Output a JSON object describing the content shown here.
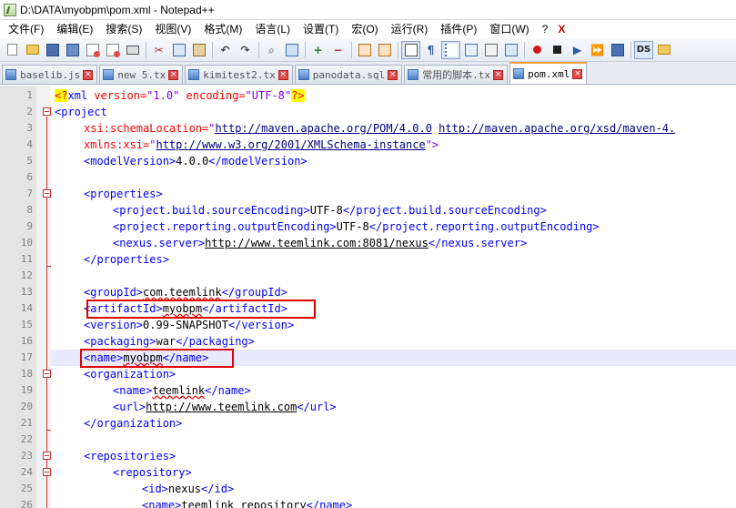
{
  "window": {
    "title": "D:\\DATA\\myobpm\\pom.xml - Notepad++"
  },
  "menu": {
    "items": [
      "文件(F)",
      "编辑(E)",
      "搜索(S)",
      "视图(V)",
      "格式(M)",
      "语言(L)",
      "设置(T)",
      "宏(O)",
      "运行(R)",
      "插件(P)",
      "窗口(W)",
      "?"
    ],
    "close_label": "X"
  },
  "toolbar": {
    "icons": [
      "new-file-icon",
      "open-file-icon",
      "save-icon",
      "save-all-icon",
      "close-icon",
      "close-all-icon",
      "print-icon",
      "cut-icon",
      "copy-icon",
      "paste-icon",
      "undo-icon",
      "redo-icon",
      "find-icon",
      "replace-icon",
      "zoom-in-icon",
      "zoom-out-icon",
      "sync-vertical-icon",
      "sync-horizontal-icon",
      "word-wrap-icon",
      "show-all-chars-icon",
      "indent-guide-icon",
      "user-lang-icon",
      "doc-map-icon",
      "function-list-icon",
      "record-macro-icon",
      "stop-record-icon",
      "play-macro-icon",
      "run-macro-multiple-icon",
      "save-macro-icon",
      "ds-plugin-icon",
      "folder-plugin-icon"
    ],
    "ds_label": "DS"
  },
  "tabs": [
    {
      "label": "baselib.js",
      "active": false
    },
    {
      "label": "new  5.tx",
      "active": false
    },
    {
      "label": "kimitest2.tx",
      "active": false
    },
    {
      "label": "panodata.sql",
      "active": false
    },
    {
      "label": "常用的脚本.tx",
      "active": false
    },
    {
      "label": "pom.xml",
      "active": true
    }
  ],
  "editor": {
    "current_line": 17,
    "lines": [
      {
        "n": "1"
      },
      {
        "n": "2"
      },
      {
        "n": "3"
      },
      {
        "n": "4"
      },
      {
        "n": "5"
      },
      {
        "n": "6"
      },
      {
        "n": "7"
      },
      {
        "n": "8"
      },
      {
        "n": "9"
      },
      {
        "n": "10"
      },
      {
        "n": "11"
      },
      {
        "n": "12"
      },
      {
        "n": "13"
      },
      {
        "n": "14"
      },
      {
        "n": "15"
      },
      {
        "n": "16"
      },
      {
        "n": "17"
      },
      {
        "n": "18"
      },
      {
        "n": "19"
      },
      {
        "n": "20"
      },
      {
        "n": "21"
      },
      {
        "n": "22"
      },
      {
        "n": "23"
      },
      {
        "n": "24"
      },
      {
        "n": "25"
      },
      {
        "n": "26"
      }
    ],
    "code": {
      "l1_pi_open": "<?",
      "l1_xml": "xml",
      "l1_version_attr": " version=",
      "l1_version_val": "\"1.0\"",
      "l1_enc_attr": " encoding=",
      "l1_enc_val": "\"UTF-8\"",
      "l1_pi_close": "?>",
      "l2": "<project",
      "l3_attr": "xsi:schemaLocation=",
      "l3_q1": "\"",
      "l3_url1": "http://maven.apache.org/POM/4.0.0",
      "l3_url2": "http://maven.apache.org/xsd/maven-4.",
      "l4_attr": "xmlns:xsi=",
      "l4_q1": "\"",
      "l4_url": "http://www.w3.org/2001/XMLSchema-instance",
      "l4_q2": "\">",
      "l5_open": "<modelVersion>",
      "l5_text": "4.0.0",
      "l5_close": "</modelVersion>",
      "l7": "<properties>",
      "l8_open": "<project.build.sourceEncoding>",
      "l8_text": "UTF-8",
      "l8_close": "</project.build.sourceEncoding>",
      "l9_open": "<project.reporting.outputEncoding>",
      "l9_text": "UTF-8",
      "l9_close": "</project.reporting.outputEncoding>",
      "l10_open": "<nexus.server>",
      "l10_text": "http://www.teemlink.com:8081/nexus",
      "l10_close": "</nexus.server>",
      "l11": "</properties>",
      "l13_open": "<groupId>",
      "l13_text": "com.teemlink",
      "l13_close": "</groupId>",
      "l14_open": "<artifactId>",
      "l14_text": "myobpm",
      "l14_close": "</artifactId>",
      "l15_open": "<version>",
      "l15_text": "0.99-SNAPSHOT",
      "l15_close": "</version>",
      "l16_open": "<packaging>",
      "l16_text": "war",
      "l16_close": "</packaging>",
      "l17_open": "<name>",
      "l17_text": "myobpm",
      "l17_close": "</name>",
      "l18": "<organization>",
      "l19_open": "<name>",
      "l19_text": "teemlink",
      "l19_close": "</name>",
      "l20_open": "<url>",
      "l20_text": "http://www.teemlink.com",
      "l20_close": "</url>",
      "l21": "</organization>",
      "l23": "<repositories>",
      "l24": "<repository>",
      "l25_open": "<id>",
      "l25_text": "nexus",
      "l25_close": "</id>",
      "l26_open": "<name>",
      "l26_text": "teemlink repository",
      "l26_close": "</name>"
    }
  },
  "colors": {
    "tag": "#0000ff",
    "attribute": "#ff0000",
    "value": "#8000ff",
    "highlight_box": "#e00000",
    "current_line": "#e8e8ff"
  }
}
